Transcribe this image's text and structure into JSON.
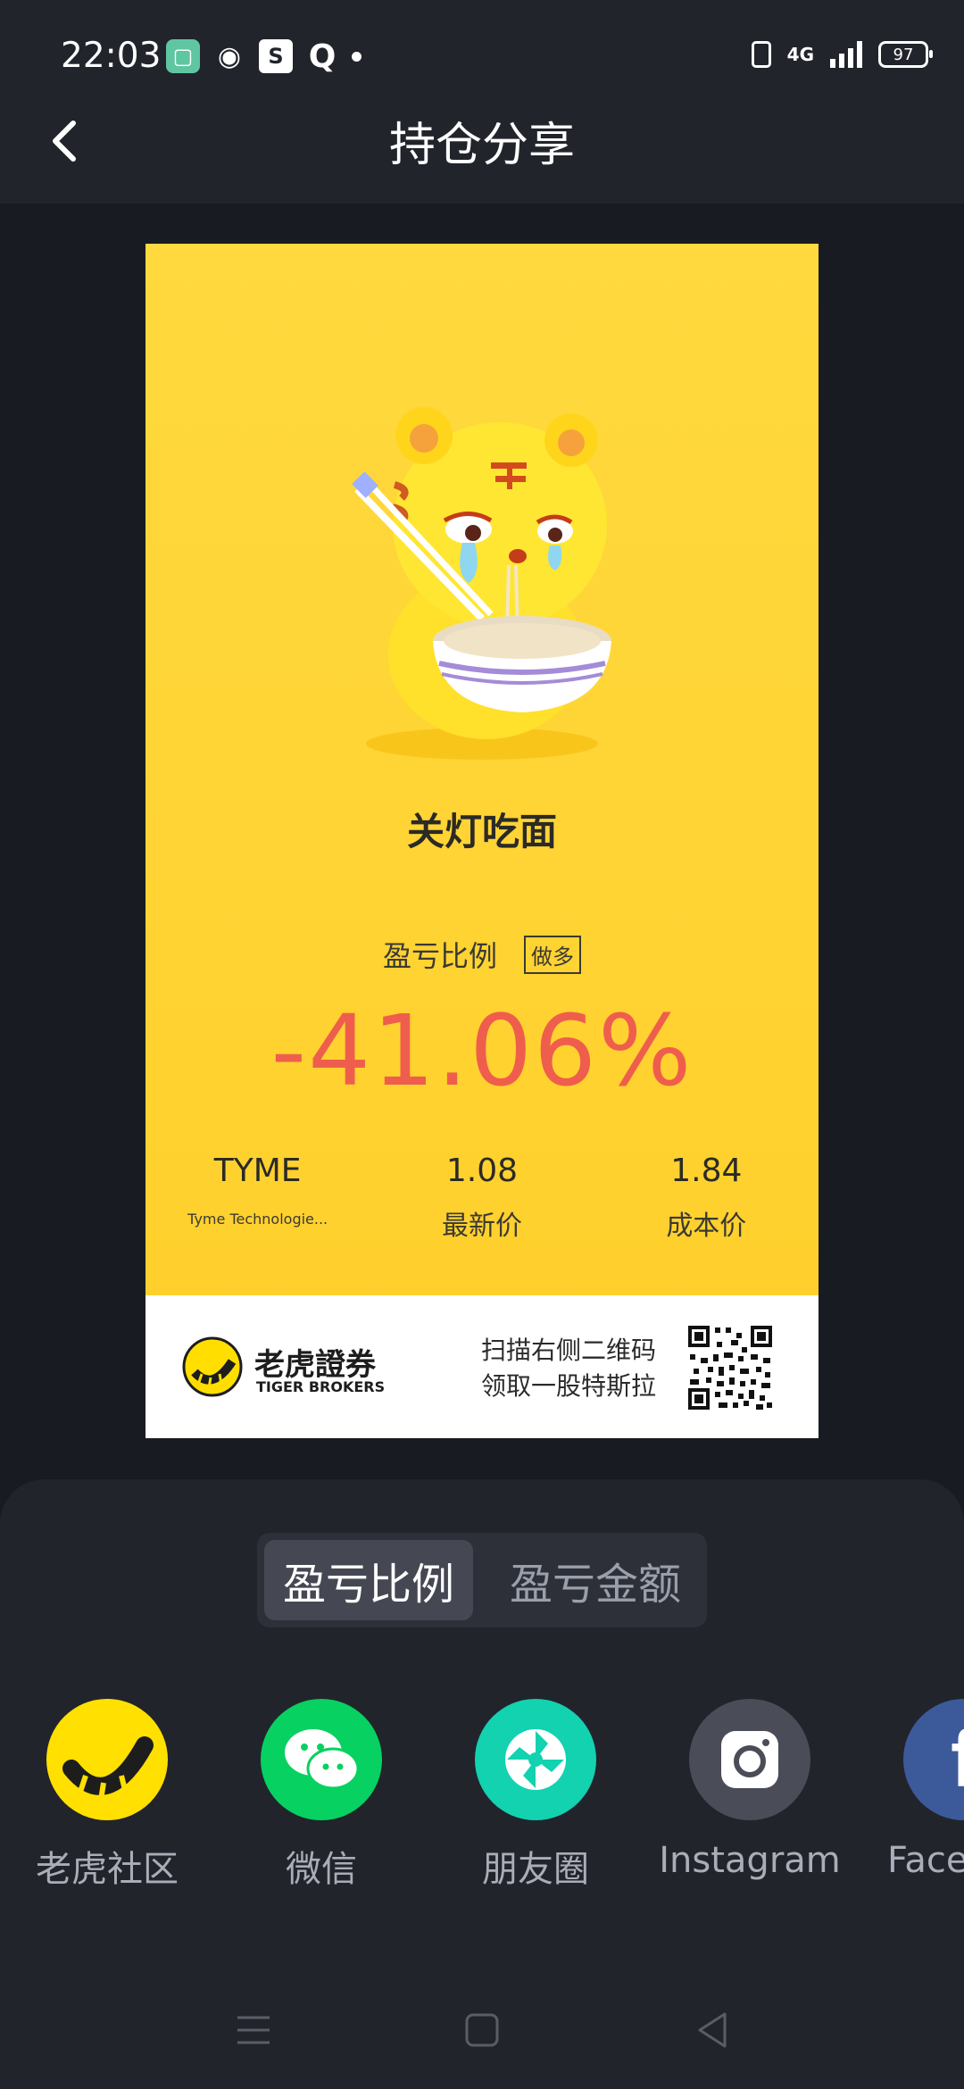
{
  "status_bar": {
    "time": "22:03",
    "network": "4G",
    "battery": "97"
  },
  "header": {
    "title": "持仓分享"
  },
  "card": {
    "title": "关灯吃面",
    "ratio_label": "盈亏比例",
    "ratio_tag": "做多",
    "ratio_value": "-41.06%",
    "stock_symbol": "TYME",
    "stock_name": "Tyme Technologie...",
    "latest_price": "1.08",
    "latest_price_label": "最新价",
    "cost_price": "1.84",
    "cost_price_label": "成本价",
    "brand_cn": "老虎證券",
    "brand_en": "TIGER BROKERS",
    "promo_line1": "扫描右侧二维码",
    "promo_line2": "领取一股特斯拉",
    "colors": {
      "background": "#ffd93e",
      "loss": "#ef5e4c"
    }
  },
  "segment": {
    "active": "盈亏比例",
    "inactive": "盈亏金额"
  },
  "share_targets": [
    {
      "label": "老虎社区",
      "icon": "tiger-community-icon",
      "color": "#ffe000"
    },
    {
      "label": "微信",
      "icon": "wechat-icon",
      "color": "#07d160"
    },
    {
      "label": "朋友圈",
      "icon": "moments-icon",
      "color": "#12d2b0"
    },
    {
      "label": "Instagram",
      "icon": "instagram-icon",
      "color": "#4a4d58"
    },
    {
      "label": "Face",
      "icon": "facebook-icon",
      "color": "#3c5a9a"
    }
  ]
}
